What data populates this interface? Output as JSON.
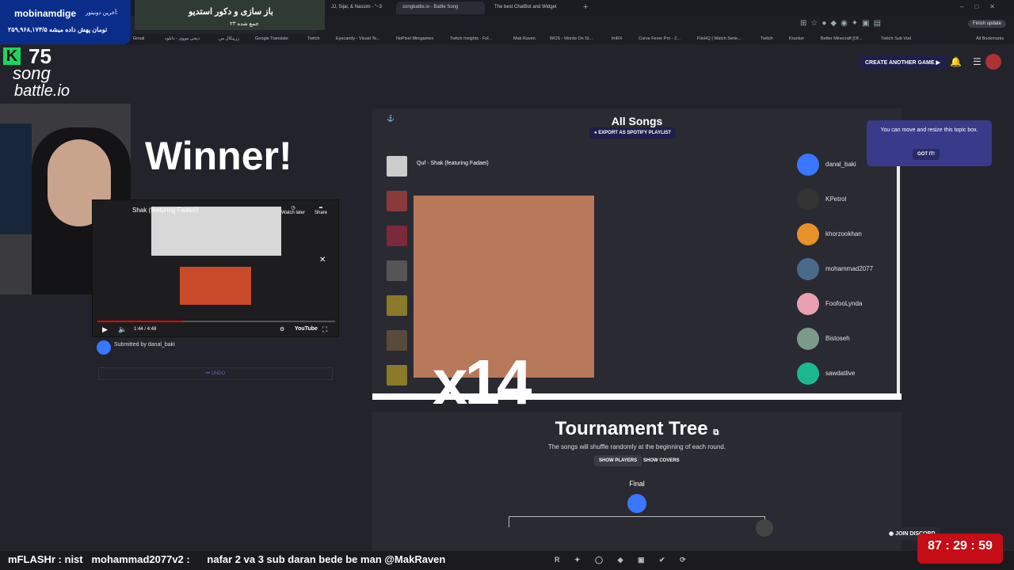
{
  "colors": {
    "page_bg": "#23232b",
    "panel_bg": "#2a2a33",
    "accent": "#3a77ff",
    "cta": "#1e1f4a",
    "donate_bg": "#0a2d8a",
    "timer_bg": "#c40d16"
  },
  "browser": {
    "tabs": [
      {
        "label": "JJ, Sijal, & Nassim - \"~3"
      },
      {
        "label": "songbattle.io - Battle Song",
        "active": true
      },
      {
        "label": "The best ChatBot and Widget"
      }
    ],
    "finish_update": "Finish update",
    "bookmarks": [
      "Gmail",
      "دیجی مووی - دانلود",
      "زرپیکال من",
      "Google Translate",
      "Twitch",
      "Eyecandy - Visual Te...",
      "NoPixel Minigames",
      "Twitch Insights - Fol...",
      "Mak Raven",
      "WOS - Words On St...",
      "lmRX",
      "Curve Fever Pro - 2...",
      "FlixHQ | Watch Serie...",
      "Twitch",
      "Krunker",
      "Better Minecraft [Of...",
      "Twitch Sub Vod"
    ],
    "all_bookmarks": "All Bookmarks"
  },
  "overlay": {
    "donate_title": "mobinamdige",
    "donate_label": "آخرین دونیتور:",
    "donate_amount": "۲۵۹,۹۶۸,۱۷۴/۵ تومان پهش داده میشه",
    "banner_title": "باز سازی و دکور استدیو",
    "banner_sub": "۲۳ جمع شده",
    "x_count": "x14",
    "ticker": "mFLASHr : nist   mohammad2077v2 :      nafar 2 va 3 sub daran bede be man @MakRaven",
    "timer": "87 : 29 : 59"
  },
  "site": {
    "logo_count": "75",
    "logo_line1": "song",
    "logo_line2": "battle.io",
    "create_game": "CREATE ANOTHER GAME",
    "winner": "Winner!",
    "video_title": "Shak (featuring Fadaei)",
    "video_time": "1:44 / 4:48",
    "watch_later": "Watch later",
    "share": "Share",
    "youtube": "YouTube",
    "submitted_by": "Submitted by danal_baki",
    "undo": "UNDO",
    "all_songs": "All Songs",
    "export_spotify": "EXPORT AS SPOTIFY PLAYLIST",
    "songs": [
      "Quf - Shak (featuring Fadaei)"
    ],
    "tooltip": "You can move and resize this topic box.",
    "got_it": "GOT IT!",
    "players": [
      "danal_baki",
      "KPetrol",
      "khorzookhan",
      "mohammad2077",
      "FoofooLynda",
      "Bistoseh",
      "sawdatlive"
    ],
    "tree_title": "Tournament Tree",
    "tree_sub": "The songs will shuffle randomly at the beginning of each round.",
    "show_players": "SHOW PLAYERS",
    "show_covers": "SHOW COVERS",
    "final": "Final",
    "join_discord": "JOIN DISCORD"
  }
}
